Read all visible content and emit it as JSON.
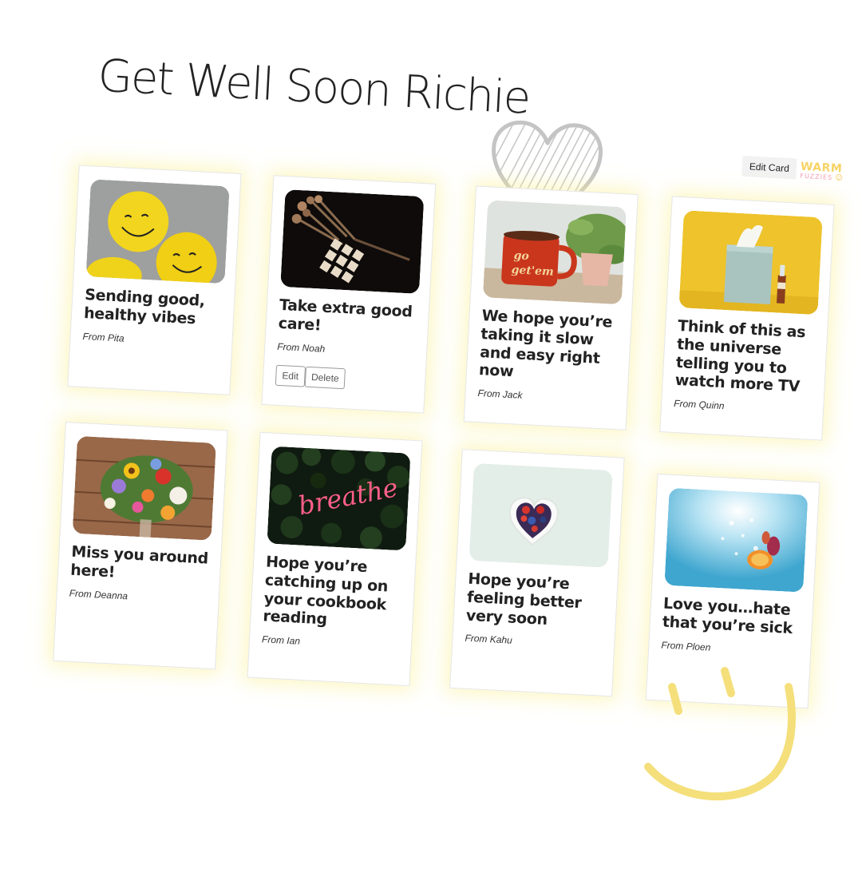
{
  "page": {
    "title": "Get Well Soon Richie",
    "edit_card_label": "Edit Card",
    "brand": {
      "top": "WARM",
      "bottom": "FUZZIES",
      "smile": "☺"
    }
  },
  "colors": {
    "accent_yellow": "#f6d365",
    "brand_pink": "#f29bb8",
    "card_glow": "#faf096"
  },
  "cards": [
    {
      "message": "Sending good, healthy vibes",
      "from": "From Pita",
      "image": "yellow-smiley-balls-photo"
    },
    {
      "message": "Take extra good care!",
      "from": "From Noah",
      "image": "dried-flowers-get-well-soon-tiles-photo",
      "actions": {
        "edit": "Edit",
        "delete": "Delete"
      }
    },
    {
      "message": "We hope you’re taking it slow and easy right now",
      "from": "From Jack",
      "image": "go-get-em-mug-photo"
    },
    {
      "message": "Think of this as the universe telling you to watch more TV",
      "from": "From Quinn",
      "image": "tissue-box-yellow-photo"
    },
    {
      "message": "Miss you around here!",
      "from": "From Deanna",
      "image": "flower-bouquet-photo"
    },
    {
      "message": "Hope you’re catching up on your cookbook reading",
      "from": "From Ian",
      "image": "breathe-neon-sign-photo"
    },
    {
      "message": "Hope you’re feeling better very soon",
      "from": "From Kahu",
      "image": "heart-bowl-berries-photo"
    },
    {
      "message": "Love you…hate that you’re sick",
      "from": "From Ploen",
      "image": "fruit-underwater-photo"
    }
  ]
}
